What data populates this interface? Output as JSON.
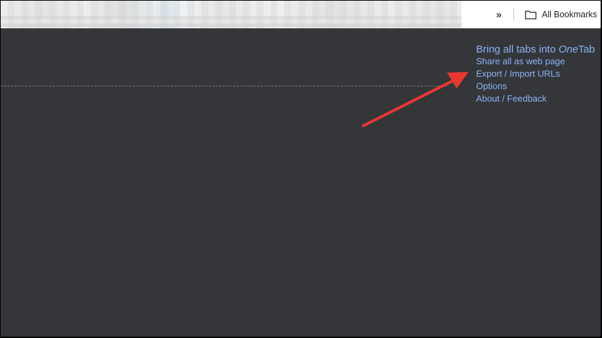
{
  "bookmarks_bar": {
    "overflow_icon": "chevron-double-right-icon",
    "folder_icon": "folder-icon",
    "all_bookmarks_label": "All Bookmarks"
  },
  "onetab_menu": {
    "primary_prefix": "Bring all tabs into ",
    "primary_brand_italic": "One",
    "primary_brand_suffix": "Tab",
    "items": [
      "Share all as web page",
      "Export / Import URLs",
      "Options",
      "About / Feedback"
    ]
  },
  "annotation": {
    "arrow_color": "#e8382e",
    "arrow_target": "Export / Import URLs"
  },
  "colors": {
    "background": "#35363a",
    "link": "#8ab4f8",
    "bar": "#ffffff"
  }
}
